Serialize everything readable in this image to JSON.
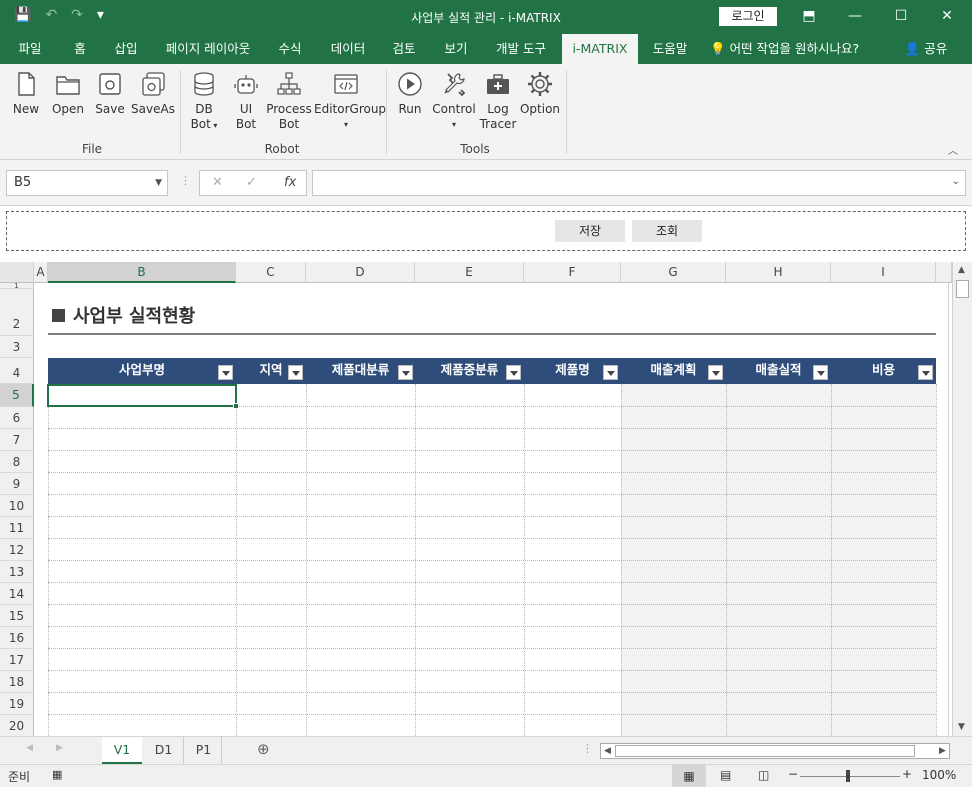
{
  "window": {
    "title": "사업부 실적 관리  -  i-MATRIX",
    "login_label": "로그인",
    "qat": {
      "save": "💾",
      "undo": "↶",
      "redo": "↷",
      "more": "▾"
    },
    "controls": {
      "ribbon_display": "⬒",
      "minimize": "—",
      "maximize": "☐",
      "close": "✕"
    }
  },
  "tabs": [
    {
      "label": "파일"
    },
    {
      "label": "홈"
    },
    {
      "label": "삽입"
    },
    {
      "label": "페이지 레이아웃"
    },
    {
      "label": "수식"
    },
    {
      "label": "데이터"
    },
    {
      "label": "검토"
    },
    {
      "label": "보기"
    },
    {
      "label": "개발 도구"
    },
    {
      "label": "i-MATRIX"
    },
    {
      "label": "도움말"
    }
  ],
  "tell_me": "어떤 작업을 원하시나요?",
  "share": "공유",
  "ribbon": {
    "file_group": "File",
    "robot_group": "Robot",
    "tools_group": "Tools",
    "new": "New",
    "open": "Open",
    "save": "Save",
    "saveas": "SaveAs",
    "db_bot_1": "DB",
    "db_bot_2": "Bot",
    "ui_bot_1": "UI",
    "ui_bot_2": "Bot",
    "process_bot_1": "Process",
    "process_bot_2": "Bot",
    "editor_group": "EditorGroup",
    "run": "Run",
    "control": "Control",
    "log_tracer_1": "Log",
    "log_tracer_2": "Tracer",
    "option": "Option"
  },
  "formula_bar": {
    "name_box": "B5",
    "fx": "fx",
    "cancel": "✕",
    "enter": "✓",
    "value": ""
  },
  "band": {
    "save_label": "저장",
    "search_label": "조회"
  },
  "columns": [
    "A",
    "B",
    "C",
    "D",
    "E",
    "F",
    "G",
    "H",
    "I"
  ],
  "rows": [
    "1",
    "2",
    "3",
    "4",
    "5",
    "6",
    "7",
    "8",
    "9",
    "10",
    "11",
    "12",
    "13",
    "14",
    "15",
    "16",
    "17",
    "18",
    "19",
    "20"
  ],
  "sheet": {
    "title": "사업부 실적현황",
    "headers": [
      "사업부명",
      "지역",
      "제품대분류",
      "제품중분류",
      "제품명",
      "매출계획",
      "매출실적",
      "비용"
    ]
  },
  "sheet_tabs": [
    {
      "label": "V1"
    },
    {
      "label": "D1"
    },
    {
      "label": "P1"
    }
  ],
  "status": {
    "ready": "준비",
    "zoom": "100%"
  }
}
